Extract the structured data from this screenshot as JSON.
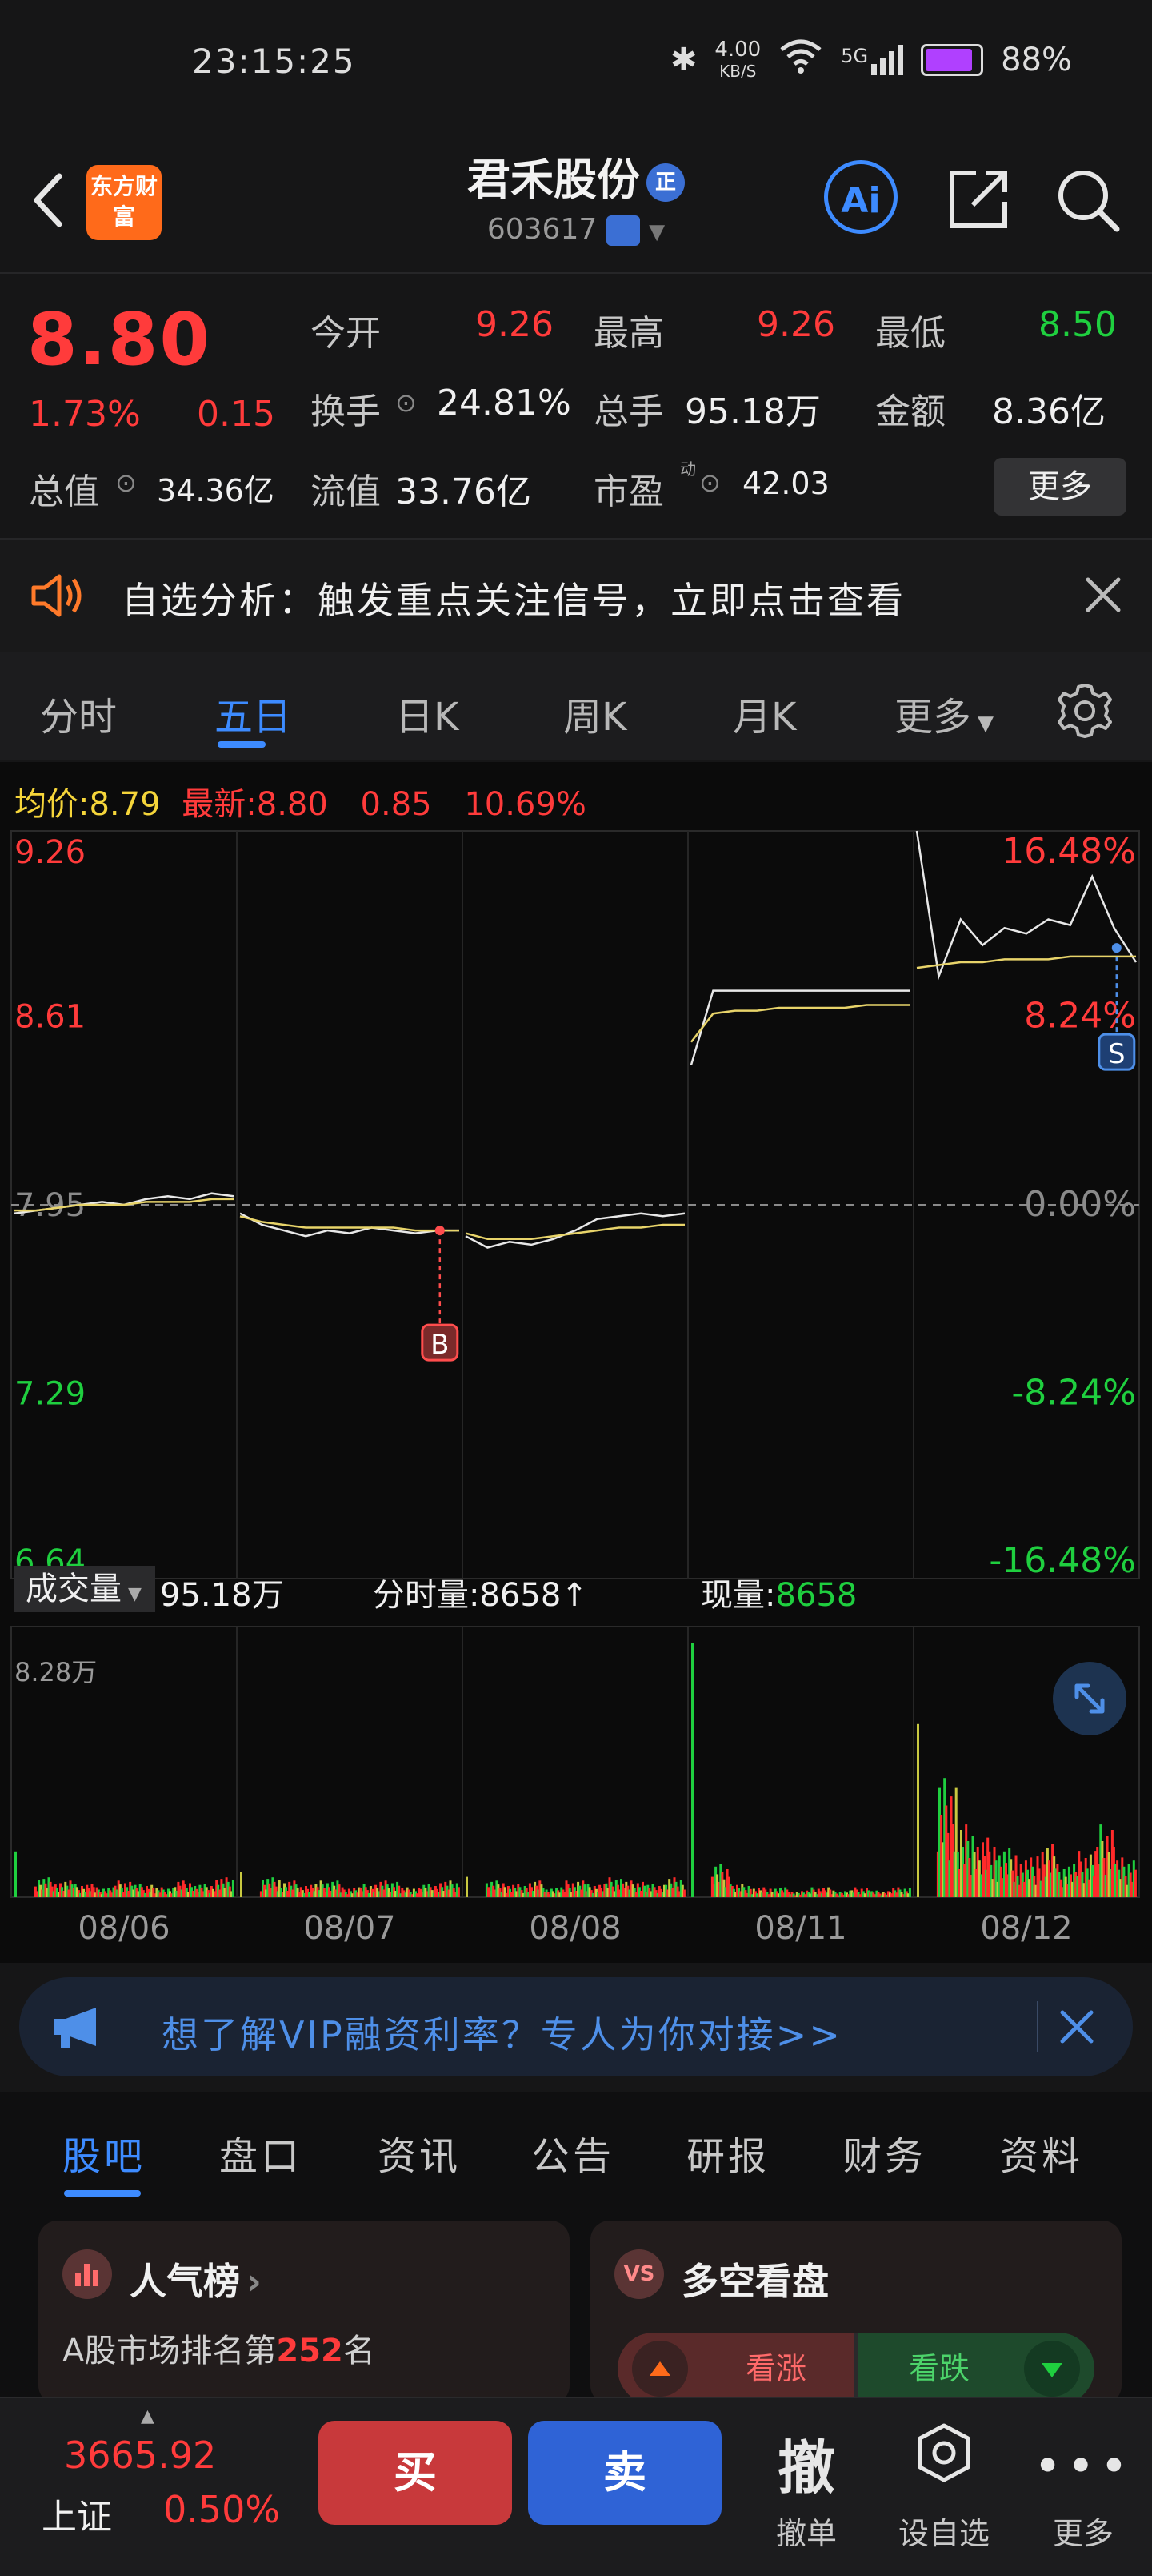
{
  "status_bar": {
    "time": "23:15:25",
    "net_speed": "4.00",
    "net_unit": "KB/S",
    "network": "5G",
    "battery": "88%"
  },
  "header": {
    "brand": "东方财富",
    "stock_name": "君禾股份",
    "stock_badge": "正",
    "stock_code": "603617",
    "ai_label": "Ai"
  },
  "quote": {
    "last_price": "8.80",
    "change_pct": "1.73%",
    "change_amt": "0.15",
    "open_label": "今开",
    "open": "9.26",
    "high_label": "最高",
    "high": "9.26",
    "low_label": "最低",
    "low": "8.50",
    "turnover_label": "换手",
    "turnover": "24.81%",
    "volume_label": "总手",
    "volume": "95.18万",
    "amount_label": "金额",
    "amount": "8.36亿",
    "mktcap_label": "总值",
    "mktcap": "34.36亿",
    "float_label": "流值",
    "float_cap": "33.76亿",
    "pe_label": "市盈",
    "pe_sup": "动",
    "pe": "42.03",
    "more_label": "更多"
  },
  "alert": {
    "text": "自选分析：触发重点关注信号，立即点击查看"
  },
  "chart_tabs": [
    "分时",
    "五日",
    "日K",
    "周K",
    "月K",
    "更多"
  ],
  "price_legend": {
    "avg_label": "均价:",
    "avg_value": "8.79",
    "latest_label": "最新:",
    "latest_value": "8.80",
    "change": "0.85",
    "pct": "10.69%"
  },
  "volume_legend": {
    "selector": "成交量",
    "total": "95.18万",
    "tick_label": "分时量:",
    "tick_value": "8658",
    "now_label": "现量:",
    "now_value": "8658",
    "max_label": "8.28万"
  },
  "vip_banner": {
    "text": "想了解VIP融资利率？专人为你对接>>"
  },
  "bottom_tabs": [
    "股吧",
    "盘口",
    "资讯",
    "公告",
    "研报",
    "财务",
    "资料"
  ],
  "cards": {
    "hot_title": "人气榜",
    "hot_rank_prefix": "A股市场排名第",
    "hot_rank": "252",
    "hot_rank_suffix": "名",
    "bullbear_badge": "VS",
    "bullbear_title": "多空看盘",
    "bull_label": "看涨",
    "bear_label": "看跌"
  },
  "toolbar": {
    "index_value": "3665.92",
    "index_name": "上证",
    "index_pct": "0.50%",
    "buy_label": "买",
    "sell_label": "卖",
    "cancel_glyph": "撤",
    "cancel_label": "撤单",
    "watch_label": "设自选",
    "more_label": "更多"
  },
  "chart_data": {
    "type": "line",
    "title": "",
    "x_labels": [
      "08/06",
      "08/07",
      "08/08",
      "08/11",
      "08/12"
    ],
    "y_left_ticks": [
      "9.26",
      "8.61",
      "7.95",
      "7.29",
      "6.64"
    ],
    "y_right_ticks": [
      "16.48%",
      "8.24%",
      "0.00%",
      "-8.24%",
      "-16.48%"
    ],
    "ylim": [
      6.64,
      9.26
    ],
    "prev_close": 7.95,
    "markers": [
      {
        "label": "B",
        "day": 1,
        "price": 7.86
      },
      {
        "label": "S",
        "day": 4,
        "price": 8.85
      }
    ],
    "series": [
      {
        "name": "price",
        "color": "#e8e8e8",
        "days": [
          [
            7.92,
            7.93,
            7.94,
            7.95,
            7.96,
            7.95,
            7.97,
            7.98,
            7.97,
            7.99,
            7.98
          ],
          [
            7.92,
            7.88,
            7.86,
            7.84,
            7.86,
            7.85,
            7.87,
            7.86,
            7.85,
            7.86,
            7.86
          ],
          [
            7.84,
            7.8,
            7.82,
            7.81,
            7.83,
            7.86,
            7.9,
            7.91,
            7.92,
            7.91,
            7.92
          ],
          [
            8.44,
            8.7,
            8.7,
            8.7,
            8.7,
            8.7,
            8.7,
            8.7,
            8.7,
            8.7,
            8.7
          ],
          [
            9.26,
            8.75,
            8.95,
            8.86,
            8.92,
            8.9,
            8.95,
            8.93,
            9.1,
            8.92,
            8.8
          ]
        ]
      },
      {
        "name": "avg",
        "color": "#e8d46a",
        "days": [
          [
            7.93,
            7.93,
            7.94,
            7.95,
            7.95,
            7.95,
            7.96,
            7.96,
            7.96,
            7.97,
            7.97
          ],
          [
            7.91,
            7.89,
            7.88,
            7.87,
            7.87,
            7.87,
            7.87,
            7.87,
            7.86,
            7.86,
            7.86
          ],
          [
            7.85,
            7.83,
            7.83,
            7.83,
            7.84,
            7.85,
            7.86,
            7.87,
            7.87,
            7.88,
            7.88
          ],
          [
            8.52,
            8.62,
            8.63,
            8.63,
            8.64,
            8.64,
            8.64,
            8.64,
            8.65,
            8.65,
            8.65
          ],
          [
            8.78,
            8.79,
            8.8,
            8.8,
            8.81,
            8.81,
            8.81,
            8.82,
            8.82,
            8.82,
            8.82
          ]
        ]
      }
    ],
    "volume": {
      "max": "8.28万",
      "days": [
        [
          0.18,
          0.06,
          0.05,
          0.04,
          0.03,
          0.05,
          0.04,
          0.03,
          0.05,
          0.04,
          0.06
        ],
        [
          0.1,
          0.06,
          0.05,
          0.04,
          0.05,
          0.03,
          0.04,
          0.05,
          0.03,
          0.04,
          0.05
        ],
        [
          0.08,
          0.05,
          0.04,
          0.05,
          0.03,
          0.05,
          0.04,
          0.06,
          0.05,
          0.04,
          0.06
        ],
        [
          1.0,
          0.1,
          0.04,
          0.03,
          0.03,
          0.02,
          0.03,
          0.02,
          0.03,
          0.02,
          0.03
        ],
        [
          0.68,
          0.36,
          0.22,
          0.18,
          0.15,
          0.12,
          0.16,
          0.1,
          0.14,
          0.22,
          0.12
        ]
      ]
    }
  }
}
